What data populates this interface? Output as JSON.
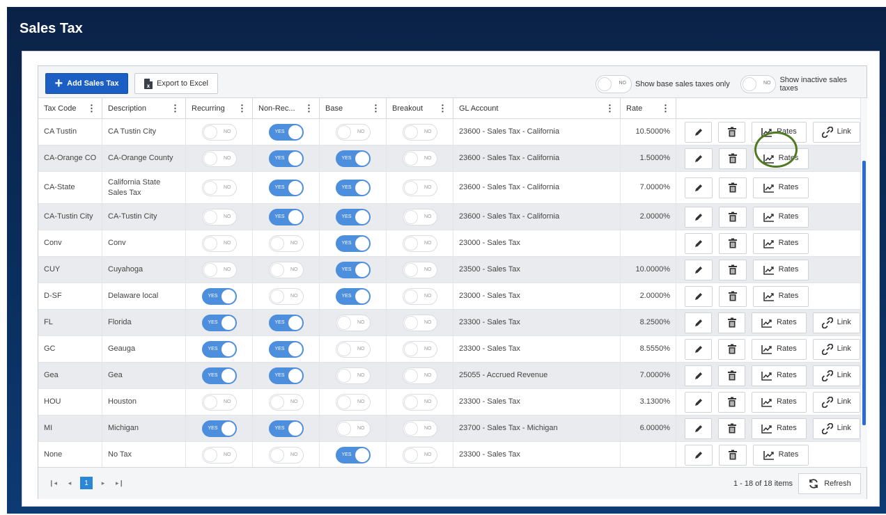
{
  "page": {
    "title": "Sales Tax"
  },
  "toolbar": {
    "add_label": "Add Sales Tax",
    "export_label": "Export to Excel",
    "filters": [
      {
        "state": "NO",
        "label": "Show base sales taxes only"
      },
      {
        "state": "NO",
        "label": "Show inactive sales taxes"
      }
    ]
  },
  "columns": [
    "Tax Code",
    "Description",
    "Recurring",
    "Non-Rec...",
    "Base",
    "Breakout",
    "GL Account",
    "Rate"
  ],
  "rows": [
    {
      "code": "CA Tustin",
      "desc": "CA Tustin City",
      "recurring": "NO",
      "nonrec": "YES",
      "base": "NO",
      "breakout": "NO",
      "gl": "23600 - Sales Tax - California",
      "rate": "10.5000%",
      "link": true
    },
    {
      "code": "CA-Orange CO",
      "desc": "CA-Orange County",
      "recurring": "NO",
      "nonrec": "YES",
      "base": "YES",
      "breakout": "NO",
      "gl": "23600 - Sales Tax - California",
      "rate": "1.5000%",
      "link": false
    },
    {
      "code": "CA-State",
      "desc": "California State Sales Tax",
      "recurring": "NO",
      "nonrec": "YES",
      "base": "YES",
      "breakout": "NO",
      "gl": "23600 - Sales Tax - California",
      "rate": "7.0000%",
      "link": false
    },
    {
      "code": "CA-Tustin City",
      "desc": "CA-Tustin City",
      "recurring": "NO",
      "nonrec": "YES",
      "base": "YES",
      "breakout": "NO",
      "gl": "23600 - Sales Tax - California",
      "rate": "2.0000%",
      "link": false
    },
    {
      "code": "Conv",
      "desc": "Conv",
      "recurring": "NO",
      "nonrec": "NO",
      "base": "YES",
      "breakout": "NO",
      "gl": "23000 - Sales Tax",
      "rate": "",
      "link": false
    },
    {
      "code": "CUY",
      "desc": "Cuyahoga",
      "recurring": "NO",
      "nonrec": "NO",
      "base": "YES",
      "breakout": "NO",
      "gl": "23500 - Sales Tax",
      "rate": "10.0000%",
      "link": false
    },
    {
      "code": "D-SF",
      "desc": "Delaware local",
      "recurring": "YES",
      "nonrec": "NO",
      "base": "YES",
      "breakout": "NO",
      "gl": "23000 - Sales Tax",
      "rate": "2.0000%",
      "link": false
    },
    {
      "code": "FL",
      "desc": "Florida",
      "recurring": "YES",
      "nonrec": "YES",
      "base": "NO",
      "breakout": "NO",
      "gl": "23300 - Sales Tax",
      "rate": "8.2500%",
      "link": true
    },
    {
      "code": "GC",
      "desc": "Geauga",
      "recurring": "YES",
      "nonrec": "YES",
      "base": "NO",
      "breakout": "NO",
      "gl": "23300 - Sales Tax",
      "rate": "8.5550%",
      "link": true
    },
    {
      "code": "Gea",
      "desc": "Gea",
      "recurring": "YES",
      "nonrec": "YES",
      "base": "NO",
      "breakout": "NO",
      "gl": "25055 - Accrued Revenue",
      "rate": "7.0000%",
      "link": true
    },
    {
      "code": "HOU",
      "desc": "Houston",
      "recurring": "NO",
      "nonrec": "NO",
      "base": "NO",
      "breakout": "NO",
      "gl": "23300 - Sales Tax",
      "rate": "3.1300%",
      "link": true
    },
    {
      "code": "MI",
      "desc": "Michigan",
      "recurring": "YES",
      "nonrec": "YES",
      "base": "NO",
      "breakout": "NO",
      "gl": "23700 - Sales Tax - Michigan",
      "rate": "6.0000%",
      "link": true
    },
    {
      "code": "None",
      "desc": "No Tax",
      "recurring": "NO",
      "nonrec": "NO",
      "base": "YES",
      "breakout": "NO",
      "gl": "23300 - Sales Tax",
      "rate": "",
      "link": false
    }
  ],
  "actions": {
    "rates_label": "Rates",
    "link_label": "Link"
  },
  "footer": {
    "pager": {
      "first": "❙◂",
      "prev": "◂",
      "current": "1",
      "next": "▸",
      "last": "▸❙"
    },
    "items_text": "1 - 18 of 18 items",
    "refresh_label": "Refresh"
  },
  "colors": {
    "primary": "#1b5fc5",
    "toggle_on": "#4d8fdc",
    "highlight": "#4f7a22",
    "header_bg": "#0b2247"
  }
}
